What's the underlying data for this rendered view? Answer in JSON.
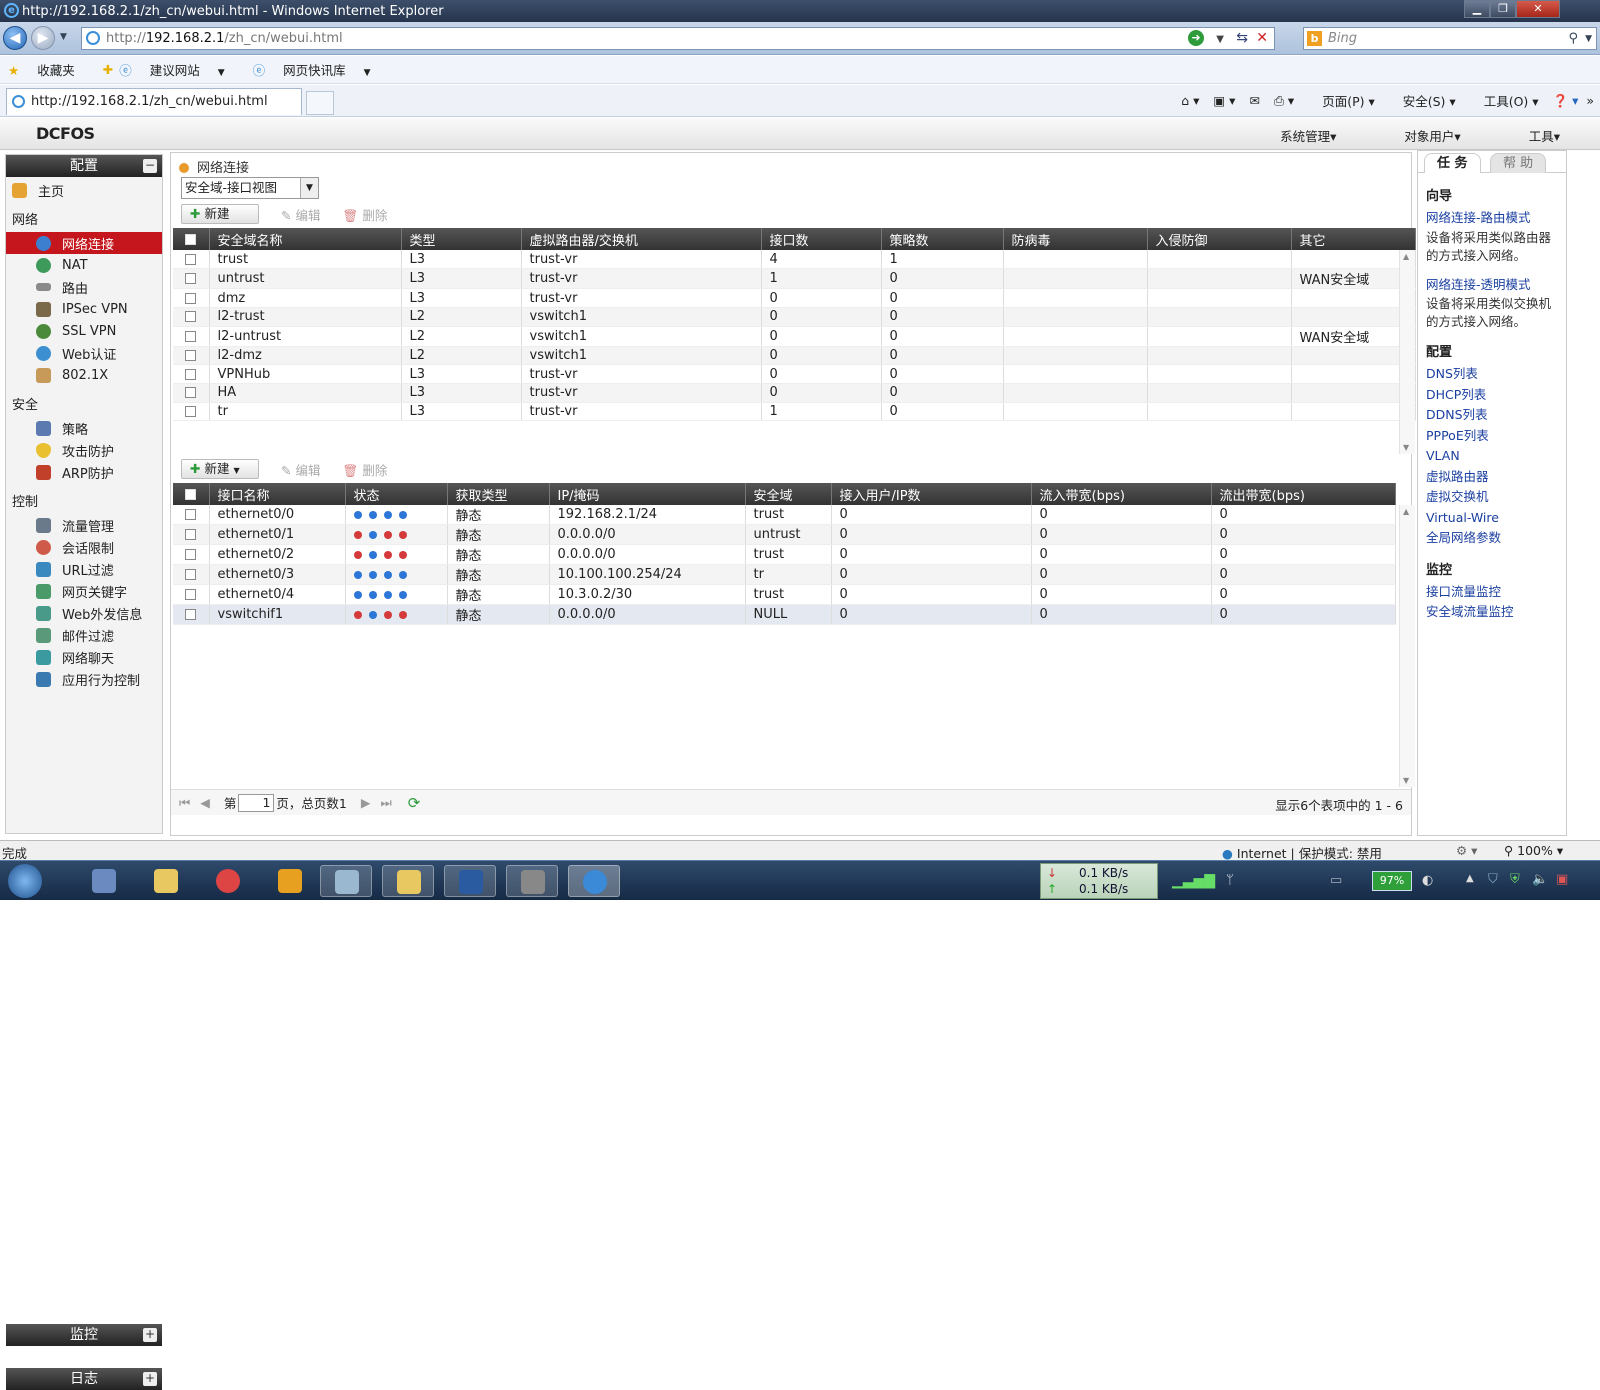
{
  "window": {
    "title": "http://192.168.2.1/zh_cn/webui.html - Windows Internet Explorer",
    "minimize": "▁",
    "maximize": "❐",
    "close": "✕"
  },
  "address": {
    "prefix": "http://",
    "host": "192.168.2.1",
    "path": "/zh_cn/webui.html",
    "search_placeholder": "Bing"
  },
  "favorites": {
    "favorites_label": "收藏夹",
    "suggested_sites": "建议网站",
    "web_slice": "网页快讯库"
  },
  "tab": {
    "title": "http://192.168.2.1/zh_cn/webui.html"
  },
  "command_bar": {
    "page": "页面(P)",
    "safety": "安全(S)",
    "tools": "工具(O)"
  },
  "app": {
    "logo": "DCFOS",
    "menu": [
      "系统管理",
      "对象用户",
      "工具"
    ]
  },
  "sidebar": {
    "header": "配置",
    "home": "主页",
    "groups": [
      {
        "label": "网络",
        "items": [
          "网络连接",
          "NAT",
          "路由",
          "IPSec VPN",
          "SSL VPN",
          "Web认证",
          "802.1X"
        ]
      },
      {
        "label": "安全",
        "items": [
          "策略",
          "攻击防护",
          "ARP防护"
        ]
      },
      {
        "label": "控制",
        "items": [
          "流量管理",
          "会话限制",
          "URL过滤",
          "网页关键字",
          "Web外发信息",
          "邮件过滤",
          "网络聊天",
          "应用行为控制"
        ]
      }
    ],
    "active_item": "网络连接",
    "footer": [
      "监控",
      "日志"
    ]
  },
  "main": {
    "breadcrumb": "网络连接",
    "view_select": "安全域-接口视图",
    "toolbar1": {
      "new": "新建",
      "edit": "编辑",
      "delete": "删除"
    },
    "zones": {
      "columns": [
        "安全域名称",
        "类型",
        "虚拟路由器/交换机",
        "接口数",
        "策略数",
        "防病毒",
        "入侵防御",
        "其它"
      ],
      "rows": [
        [
          "trust",
          "L3",
          "trust-vr",
          "4",
          "1",
          "",
          "",
          ""
        ],
        [
          "untrust",
          "L3",
          "trust-vr",
          "1",
          "0",
          "",
          "",
          "WAN安全域"
        ],
        [
          "dmz",
          "L3",
          "trust-vr",
          "0",
          "0",
          "",
          "",
          ""
        ],
        [
          "l2-trust",
          "L2",
          "vswitch1",
          "0",
          "0",
          "",
          "",
          ""
        ],
        [
          "l2-untrust",
          "L2",
          "vswitch1",
          "0",
          "0",
          "",
          "",
          "WAN安全域"
        ],
        [
          "l2-dmz",
          "L2",
          "vswitch1",
          "0",
          "0",
          "",
          "",
          ""
        ],
        [
          "VPNHub",
          "L3",
          "trust-vr",
          "0",
          "0",
          "",
          "",
          ""
        ],
        [
          "HA",
          "L3",
          "trust-vr",
          "0",
          "0",
          "",
          "",
          ""
        ],
        [
          "tr",
          "L3",
          "trust-vr",
          "1",
          "0",
          "",
          "",
          ""
        ]
      ]
    },
    "toolbar2": {
      "new": "新建",
      "edit": "编辑",
      "delete": "删除"
    },
    "interfaces": {
      "columns": [
        "接口名称",
        "状态",
        "获取类型",
        "IP/掩码",
        "安全域",
        "接入用户/IP数",
        "流入带宽(bps)",
        "流出带宽(bps)"
      ],
      "rows": [
        {
          "name": "ethernet0/0",
          "status": [
            "blue",
            "blue",
            "blue",
            "blue"
          ],
          "type": "静态",
          "ip": "192.168.2.1/24",
          "zone": "trust",
          "users": "0",
          "in": "0",
          "out": "0"
        },
        {
          "name": "ethernet0/1",
          "status": [
            "red",
            "blue",
            "red",
            "red"
          ],
          "type": "静态",
          "ip": "0.0.0.0/0",
          "zone": "untrust",
          "users": "0",
          "in": "0",
          "out": "0"
        },
        {
          "name": "ethernet0/2",
          "status": [
            "red",
            "blue",
            "red",
            "red"
          ],
          "type": "静态",
          "ip": "0.0.0.0/0",
          "zone": "trust",
          "users": "0",
          "in": "0",
          "out": "0"
        },
        {
          "name": "ethernet0/3",
          "status": [
            "blue",
            "blue",
            "blue",
            "blue"
          ],
          "type": "静态",
          "ip": "10.100.100.254/24",
          "zone": "tr",
          "users": "0",
          "in": "0",
          "out": "0"
        },
        {
          "name": "ethernet0/4",
          "status": [
            "blue",
            "blue",
            "blue",
            "blue"
          ],
          "type": "静态",
          "ip": "10.3.0.2/30",
          "zone": "trust",
          "users": "0",
          "in": "0",
          "out": "0"
        },
        {
          "name": "vswitchif1",
          "status": [
            "red",
            "blue",
            "red",
            "red"
          ],
          "type": "静态",
          "ip": "0.0.0.0/0",
          "zone": "NULL",
          "users": "0",
          "in": "0",
          "out": "0"
        }
      ]
    },
    "pager": {
      "prefix": "第",
      "page": "1",
      "suffix": "页，总页数1",
      "summary": "显示6个表项中的 1 - 6"
    }
  },
  "right_panel": {
    "tabs": [
      "任 务",
      "帮 助"
    ],
    "wizard_heading": "向导",
    "wizard": [
      {
        "link": "网络连接-路由模式",
        "desc": "设备将采用类似路由器的方式接入网络。"
      },
      {
        "link": "网络连接-透明模式",
        "desc": "设备将采用类似交换机的方式接入网络。"
      }
    ],
    "config_heading": "配置",
    "config_links": [
      "DNS列表",
      "DHCP列表",
      "DDNS列表",
      "PPPoE列表",
      "VLAN",
      "虚拟路由器",
      "虚拟交换机",
      "Virtual-Wire",
      "全局网络参数"
    ],
    "monitor_heading": "监控",
    "monitor_links": [
      "接口流量监控",
      "安全域流量监控"
    ]
  },
  "statusbar": {
    "left": "完成",
    "zone": "Internet | 保护模式: 禁用",
    "zoom": "100%"
  },
  "taskbar": {
    "down": "0.1 KB/s",
    "up": "0.1 KB/s",
    "battery": "97%"
  },
  "colors": {
    "active_nav": "#c4161c",
    "header_dark": "#333333",
    "link": "#1a3fa0",
    "status_up": "#2b76d6",
    "status_down": "#d43a3a"
  }
}
